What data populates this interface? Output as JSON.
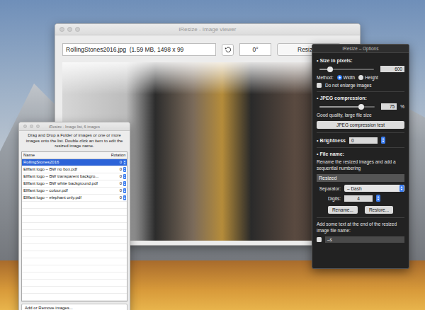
{
  "viewer": {
    "title": "iResize - Image viewer",
    "file_info": "RollingStones2016.jpg  (1.59 MB, 1498 x 99",
    "angle": "0°",
    "resize_button": "Resiz"
  },
  "image_list": {
    "title": "iResize - Image list, 6 images",
    "instructions": "Drag and Drop a Folder of images or one or more images onto the list. Double click an item to edit the resized image name.",
    "columns": [
      "Name",
      "Rotation"
    ],
    "rows": [
      {
        "name": "RollingStones2016",
        "rotation": "0",
        "selected": true
      },
      {
        "name": "Elffant logo – BW no box.pdf",
        "rotation": "0",
        "selected": false
      },
      {
        "name": "Elffant logo – BW transparent backgro...",
        "rotation": "0",
        "selected": false
      },
      {
        "name": "Elffant logo – BW white background.pdf",
        "rotation": "0",
        "selected": false
      },
      {
        "name": "Elffant logo – colour.pdf",
        "rotation": "0",
        "selected": false
      },
      {
        "name": "Elffant logo – elephant only.pdf",
        "rotation": "0",
        "selected": false
      }
    ],
    "add_button": "Add or Remove images..."
  },
  "options": {
    "title": "iResize – Options",
    "size": {
      "heading": "• Size in pixels:",
      "level": 0.2,
      "value": "600",
      "method_label": "Method:",
      "methods": [
        {
          "label": "Width",
          "selected": true
        },
        {
          "label": "Height",
          "selected": false
        }
      ],
      "no_enlarge": {
        "label": "Do not enlarge images",
        "checked": false
      }
    },
    "jpeg": {
      "heading": "• JPEG compression:",
      "level": 0.75,
      "value": "75",
      "unit": "%",
      "quality": "Good quality, large file size",
      "test_button": "JPEG compression test"
    },
    "brightness": {
      "heading": "• Brightness",
      "value": "0"
    },
    "file_name": {
      "heading": "• File name:",
      "description": "Rename the resized images and add a sequential numbering",
      "name_value": "Resized",
      "separator_label": "Separator:",
      "separator_value": "– Dash",
      "digits_label": "Digits:",
      "digits_value": "4",
      "rename_button": "Rename...",
      "restore_button": "Restore..."
    },
    "suffix": {
      "label": "Add some text at the end of the resized image file name:",
      "checked": false,
      "value": "–s"
    }
  }
}
